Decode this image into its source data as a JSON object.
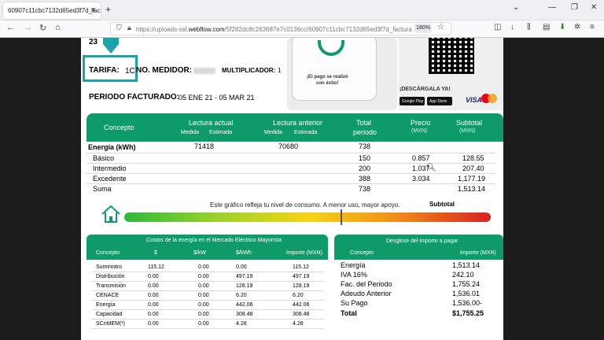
{
  "browser": {
    "tab_title": "60907c11cbc7132d65ed3f7d_factura",
    "url_prefix": "https://uploads-ssl.",
    "url_host": "webflow.com",
    "url_rest": "/5f282dc8c263687e7c0136cc/60907c11cbc7132d65ed3f7d_factura",
    "zoom": "180%"
  },
  "header": {
    "date_fragment": "23",
    "tarifa_label": "TARIFA:",
    "tarifa_value": "1C",
    "medidor_label": "NO. MEDIDOR:",
    "multiplicador_label": "MULTIPLICADOR:",
    "multiplicador_value": "1",
    "periodo_label": "PERIODO FACTURADO:",
    "periodo_value": "05 ENE 21 - 05 MAR 21"
  },
  "promo": {
    "phone_text_1": "¡El pago se realizó",
    "phone_text_2": "con éxito!",
    "download_text": "¡DESCÁRGALA YA!",
    "store_google": "Google Play",
    "store_apple": "App Store",
    "visa": "VISA"
  },
  "consumo": {
    "headers": {
      "concepto": "Concepto",
      "lectura_actual": "Lectura actual",
      "lectura_anterior": "Lectura anterior",
      "total": "Total",
      "periodo": "periodo",
      "precio": "Precio",
      "precio_unit": "(MXN)",
      "subtotal": "Subtotal",
      "subtotal_unit": "(MXN)",
      "medida": "Medida",
      "estimada": "Estimada"
    },
    "energia_label": "Energía (kWh)",
    "lectura_actual": "71418",
    "lectura_anterior": "70680",
    "total_periodo": "738",
    "rows": [
      {
        "concepto": "Básico",
        "total": "150",
        "precio": "0.857",
        "subtotal": "128.55"
      },
      {
        "concepto": "Intermedio",
        "total": "200",
        "precio": "1.037",
        "subtotal": "207.40"
      },
      {
        "concepto": "Excedente",
        "total": "388",
        "precio": "3.034",
        "subtotal": "1,177.19"
      },
      {
        "concepto": "Suma",
        "total": "738",
        "precio": "",
        "subtotal": "1,513.14"
      }
    ],
    "gauge_text": "Este gráfico refleja tu nivel de consumo. A menor uso, mayor apoyo.",
    "subtotal_label": "Subtotal"
  },
  "mercado": {
    "title": "Costos de la energía en el Mercado Eléctrico Mayorista",
    "headers": [
      "Concepto",
      "$",
      "$/kW",
      "$/kWh",
      "Importe (MXN)"
    ],
    "rows": [
      [
        "Suministro",
        "115.12",
        "0.00",
        "0.00",
        "115.12"
      ],
      [
        "Distribución",
        "0.00",
        "0.00",
        "497.19",
        "497.19"
      ],
      [
        "Transmisión",
        "0.00",
        "0.00",
        "128.19",
        "128.19"
      ],
      [
        "CENACE",
        "0.00",
        "0.00",
        "6.20",
        "6.20"
      ],
      [
        "Energía",
        "0.00",
        "0.00",
        "442.06",
        "442.06"
      ],
      [
        "Capacidad",
        "0.00",
        "0.00",
        "308.48",
        "308.48"
      ],
      [
        "SCnMEM(¹)",
        "0.00",
        "0.00",
        "4.28",
        "4.28"
      ]
    ]
  },
  "desglose": {
    "title": "Desglose del importe a pagar",
    "col_concepto": "Concepto",
    "col_importe": "Importe (MXN)",
    "rows": [
      {
        "label": "Energía",
        "value": "1,513.14"
      },
      {
        "label": "IVA 16%",
        "value": "242.10"
      },
      {
        "label": "Fac. del Periodo",
        "value": "1,755.24"
      },
      {
        "label": "Adeudo Anterior",
        "value": "1,536.01"
      },
      {
        "label": "Su Pago",
        "value": "1,536.00-"
      }
    ],
    "total_label": "Total",
    "total_value": "$1,755.25"
  },
  "colors": {
    "brand_green": "#0e9b69",
    "highlight_teal": "#1aa3a8"
  }
}
